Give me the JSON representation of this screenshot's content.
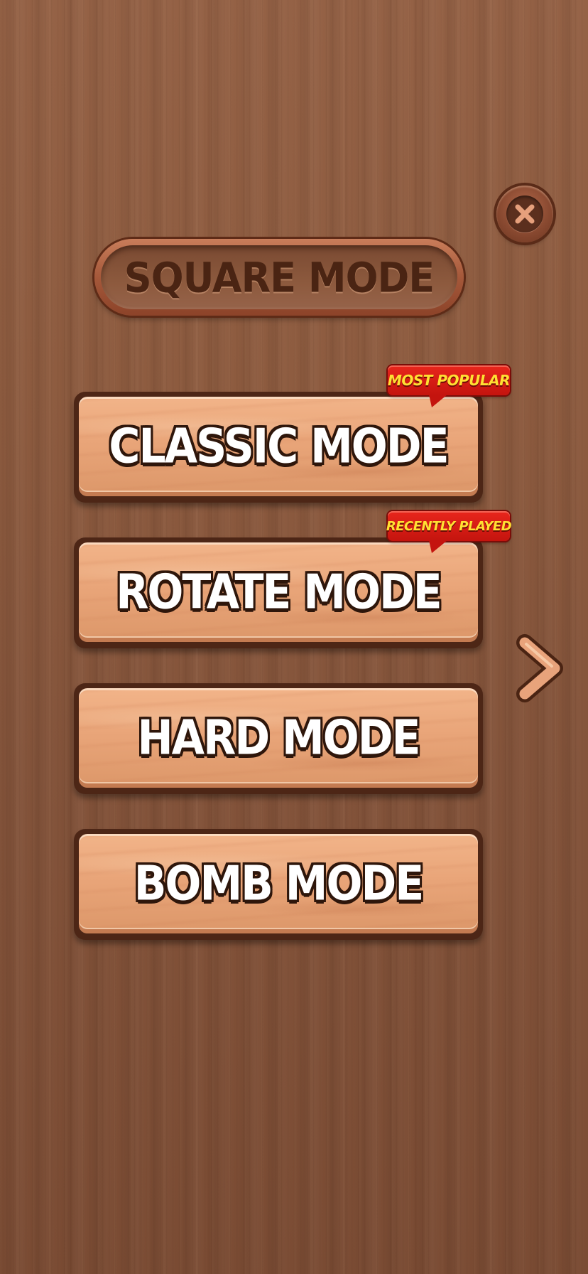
{
  "screen": {
    "title": "SQUARE MODE"
  },
  "modes": [
    {
      "label": "CLASSIC MODE",
      "badge": "MOST POPULAR"
    },
    {
      "label": "ROTATE MODE",
      "badge": "RECENTLY PLAYED"
    },
    {
      "label": "HARD MODE",
      "badge": ""
    },
    {
      "label": "BOMB MODE",
      "badge": ""
    }
  ],
  "icons": {
    "close": "close-icon",
    "next": "chevron-right-icon"
  },
  "colors": {
    "background_wood": "#8a5a3f",
    "button_face": "#e9a579",
    "button_outline": "#4d2616",
    "badge_red": "#d41a12",
    "badge_text": "#ffe033",
    "title_text": "#4a2413"
  }
}
